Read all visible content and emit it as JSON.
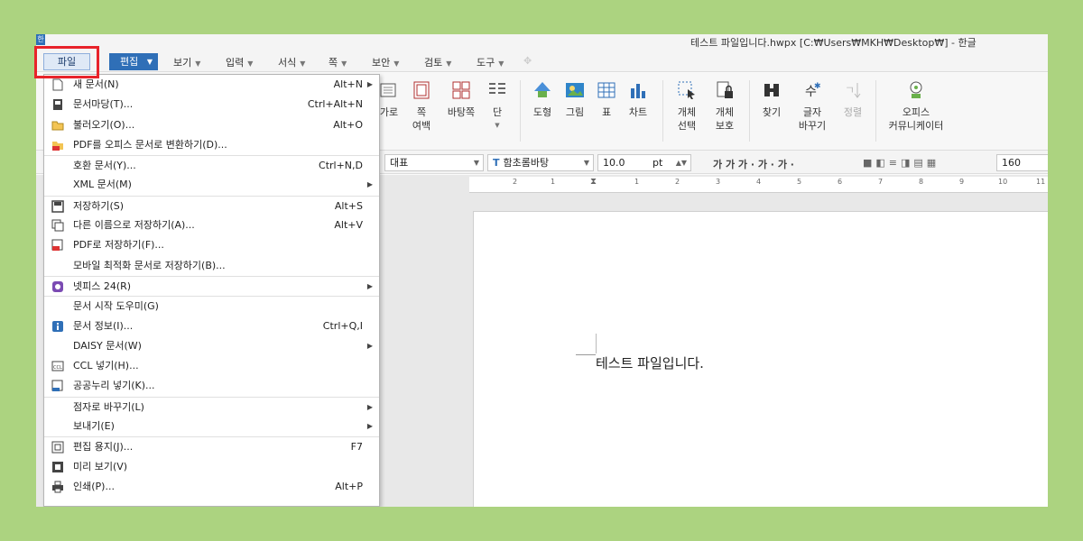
{
  "window": {
    "title": "테스트 파일입니다.hwpx [C:₩Users₩MKH₩Desktop₩] - 한글",
    "app_icon_glyph": "한"
  },
  "menubar": {
    "file": "파일",
    "edit": "편집",
    "items": [
      "보기",
      "입력",
      "서식",
      "쪽",
      "보안",
      "검토",
      "도구"
    ]
  },
  "ribbon": {
    "buttons": [
      {
        "label": "가로",
        "label2": ""
      },
      {
        "label": "쪽",
        "label2": "여백"
      },
      {
        "label": "바탕쪽",
        "label2": ""
      },
      {
        "label": "단",
        "label2": ""
      },
      {
        "label": "도형",
        "label2": ""
      },
      {
        "label": "그림",
        "label2": ""
      },
      {
        "label": "표",
        "label2": ""
      },
      {
        "label": "차트",
        "label2": ""
      },
      {
        "label": "개체",
        "label2": "선택"
      },
      {
        "label": "개체",
        "label2": "보호"
      },
      {
        "label": "찾기",
        "label2": ""
      },
      {
        "label": "글자",
        "label2": "바꾸기"
      },
      {
        "label": "정렬",
        "label2": ""
      },
      {
        "label": "오피스",
        "label2": "커뮤니케이터"
      }
    ]
  },
  "formatbar": {
    "style": "대표",
    "font": "함초롬바탕",
    "font_prefix": "T",
    "size": "10.0",
    "unit": "pt",
    "format_glyphs": "가 가 가 · 가 · 가 ·",
    "line_spacing": "160"
  },
  "ruler": {
    "numbers": [
      "2",
      "1",
      "1",
      "2",
      "3",
      "4",
      "5",
      "6",
      "7",
      "8",
      "9",
      "10",
      "11"
    ]
  },
  "document": {
    "text": "테스트 파일입니다."
  },
  "file_menu": {
    "items": [
      {
        "icon": "new-doc-icon",
        "label": "새 문서(N)",
        "shortcut": "Alt+N",
        "submenu": true,
        "sep": false
      },
      {
        "icon": "template-icon",
        "label": "문서마당(T)...",
        "shortcut": "Ctrl+Alt+N",
        "submenu": false,
        "sep": false
      },
      {
        "icon": "open-folder-icon",
        "label": "불러오기(O)...",
        "shortcut": "Alt+O",
        "submenu": false,
        "sep": false
      },
      {
        "icon": "pdf-convert-icon",
        "label": "PDF를 오피스 문서로 변환하기(D)...",
        "shortcut": "",
        "submenu": false,
        "sep": false
      },
      {
        "icon": "",
        "label": "호환 문서(Y)...",
        "shortcut": "Ctrl+N,D",
        "submenu": false,
        "sep": true
      },
      {
        "icon": "",
        "label": "XML 문서(M)",
        "shortcut": "",
        "submenu": true,
        "sep": false
      },
      {
        "icon": "save-icon",
        "label": "저장하기(S)",
        "shortcut": "Alt+S",
        "submenu": false,
        "sep": true
      },
      {
        "icon": "save-as-icon",
        "label": "다른 이름으로 저장하기(A)...",
        "shortcut": "Alt+V",
        "submenu": false,
        "sep": false
      },
      {
        "icon": "save-pdf-icon",
        "label": "PDF로 저장하기(F)...",
        "shortcut": "",
        "submenu": false,
        "sep": false
      },
      {
        "icon": "",
        "label": "모바일 최적화 문서로 저장하기(B)...",
        "shortcut": "",
        "submenu": false,
        "sep": false
      },
      {
        "icon": "netffice-icon",
        "label": "넷피스 24(R)",
        "shortcut": "",
        "submenu": true,
        "sep": true
      },
      {
        "icon": "",
        "label": "문서 시작 도우미(G)",
        "shortcut": "",
        "submenu": false,
        "sep": true
      },
      {
        "icon": "doc-info-icon",
        "label": "문서 정보(I)...",
        "shortcut": "Ctrl+Q,I",
        "submenu": false,
        "sep": false
      },
      {
        "icon": "",
        "label": "DAISY 문서(W)",
        "shortcut": "",
        "submenu": true,
        "sep": false
      },
      {
        "icon": "ccl-icon",
        "label": "CCL 넣기(H)...",
        "shortcut": "",
        "submenu": false,
        "sep": false
      },
      {
        "icon": "public-license-icon",
        "label": "공공누리 넣기(K)...",
        "shortcut": "",
        "submenu": false,
        "sep": false
      },
      {
        "icon": "",
        "label": "점자로 바꾸기(L)",
        "shortcut": "",
        "submenu": true,
        "sep": true
      },
      {
        "icon": "",
        "label": "보내기(E)",
        "shortcut": "",
        "submenu": true,
        "sep": false
      },
      {
        "icon": "page-setup-icon",
        "label": "편집 용지(J)...",
        "shortcut": "F7",
        "submenu": false,
        "sep": true
      },
      {
        "icon": "preview-icon",
        "label": "미리 보기(V)",
        "shortcut": "",
        "submenu": false,
        "sep": false
      },
      {
        "icon": "print-icon",
        "label": "인쇄(P)...",
        "shortcut": "Alt+P",
        "submenu": false,
        "sep": false
      }
    ]
  }
}
